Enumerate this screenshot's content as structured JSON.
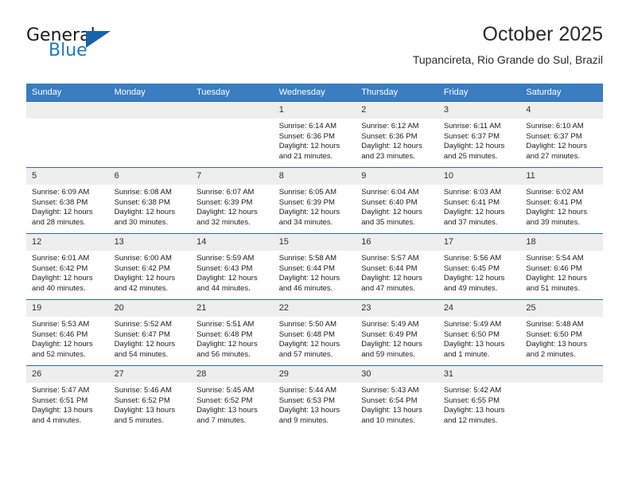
{
  "logo": {
    "word1": "General",
    "word2": "Blue",
    "triangle_icon": "blue-triangle-icon",
    "color_dark": "#1b1b1b",
    "color_blue": "#1f7ac0",
    "color_triangle": "#1863a8"
  },
  "header": {
    "title": "October 2025",
    "subtitle": "Tupancireta, Rio Grande do Sul, Brazil"
  },
  "colors": {
    "header_row_bg": "#3a7dc0",
    "daynum_bg": "#eeeeee",
    "row_border": "#2d6ca8",
    "text": "#1c1c1c"
  },
  "weekdays": [
    "Sunday",
    "Monday",
    "Tuesday",
    "Wednesday",
    "Thursday",
    "Friday",
    "Saturday"
  ],
  "weeks": [
    [
      {
        "day": "",
        "sunrise": "",
        "sunset": "",
        "daylight1": "",
        "daylight2": ""
      },
      {
        "day": "",
        "sunrise": "",
        "sunset": "",
        "daylight1": "",
        "daylight2": ""
      },
      {
        "day": "",
        "sunrise": "",
        "sunset": "",
        "daylight1": "",
        "daylight2": ""
      },
      {
        "day": "1",
        "sunrise": "Sunrise: 6:14 AM",
        "sunset": "Sunset: 6:36 PM",
        "daylight1": "Daylight: 12 hours",
        "daylight2": "and 21 minutes."
      },
      {
        "day": "2",
        "sunrise": "Sunrise: 6:12 AM",
        "sunset": "Sunset: 6:36 PM",
        "daylight1": "Daylight: 12 hours",
        "daylight2": "and 23 minutes."
      },
      {
        "day": "3",
        "sunrise": "Sunrise: 6:11 AM",
        "sunset": "Sunset: 6:37 PM",
        "daylight1": "Daylight: 12 hours",
        "daylight2": "and 25 minutes."
      },
      {
        "day": "4",
        "sunrise": "Sunrise: 6:10 AM",
        "sunset": "Sunset: 6:37 PM",
        "daylight1": "Daylight: 12 hours",
        "daylight2": "and 27 minutes."
      }
    ],
    [
      {
        "day": "5",
        "sunrise": "Sunrise: 6:09 AM",
        "sunset": "Sunset: 6:38 PM",
        "daylight1": "Daylight: 12 hours",
        "daylight2": "and 28 minutes."
      },
      {
        "day": "6",
        "sunrise": "Sunrise: 6:08 AM",
        "sunset": "Sunset: 6:38 PM",
        "daylight1": "Daylight: 12 hours",
        "daylight2": "and 30 minutes."
      },
      {
        "day": "7",
        "sunrise": "Sunrise: 6:07 AM",
        "sunset": "Sunset: 6:39 PM",
        "daylight1": "Daylight: 12 hours",
        "daylight2": "and 32 minutes."
      },
      {
        "day": "8",
        "sunrise": "Sunrise: 6:05 AM",
        "sunset": "Sunset: 6:39 PM",
        "daylight1": "Daylight: 12 hours",
        "daylight2": "and 34 minutes."
      },
      {
        "day": "9",
        "sunrise": "Sunrise: 6:04 AM",
        "sunset": "Sunset: 6:40 PM",
        "daylight1": "Daylight: 12 hours",
        "daylight2": "and 35 minutes."
      },
      {
        "day": "10",
        "sunrise": "Sunrise: 6:03 AM",
        "sunset": "Sunset: 6:41 PM",
        "daylight1": "Daylight: 12 hours",
        "daylight2": "and 37 minutes."
      },
      {
        "day": "11",
        "sunrise": "Sunrise: 6:02 AM",
        "sunset": "Sunset: 6:41 PM",
        "daylight1": "Daylight: 12 hours",
        "daylight2": "and 39 minutes."
      }
    ],
    [
      {
        "day": "12",
        "sunrise": "Sunrise: 6:01 AM",
        "sunset": "Sunset: 6:42 PM",
        "daylight1": "Daylight: 12 hours",
        "daylight2": "and 40 minutes."
      },
      {
        "day": "13",
        "sunrise": "Sunrise: 6:00 AM",
        "sunset": "Sunset: 6:42 PM",
        "daylight1": "Daylight: 12 hours",
        "daylight2": "and 42 minutes."
      },
      {
        "day": "14",
        "sunrise": "Sunrise: 5:59 AM",
        "sunset": "Sunset: 6:43 PM",
        "daylight1": "Daylight: 12 hours",
        "daylight2": "and 44 minutes."
      },
      {
        "day": "15",
        "sunrise": "Sunrise: 5:58 AM",
        "sunset": "Sunset: 6:44 PM",
        "daylight1": "Daylight: 12 hours",
        "daylight2": "and 46 minutes."
      },
      {
        "day": "16",
        "sunrise": "Sunrise: 5:57 AM",
        "sunset": "Sunset: 6:44 PM",
        "daylight1": "Daylight: 12 hours",
        "daylight2": "and 47 minutes."
      },
      {
        "day": "17",
        "sunrise": "Sunrise: 5:56 AM",
        "sunset": "Sunset: 6:45 PM",
        "daylight1": "Daylight: 12 hours",
        "daylight2": "and 49 minutes."
      },
      {
        "day": "18",
        "sunrise": "Sunrise: 5:54 AM",
        "sunset": "Sunset: 6:46 PM",
        "daylight1": "Daylight: 12 hours",
        "daylight2": "and 51 minutes."
      }
    ],
    [
      {
        "day": "19",
        "sunrise": "Sunrise: 5:53 AM",
        "sunset": "Sunset: 6:46 PM",
        "daylight1": "Daylight: 12 hours",
        "daylight2": "and 52 minutes."
      },
      {
        "day": "20",
        "sunrise": "Sunrise: 5:52 AM",
        "sunset": "Sunset: 6:47 PM",
        "daylight1": "Daylight: 12 hours",
        "daylight2": "and 54 minutes."
      },
      {
        "day": "21",
        "sunrise": "Sunrise: 5:51 AM",
        "sunset": "Sunset: 6:48 PM",
        "daylight1": "Daylight: 12 hours",
        "daylight2": "and 56 minutes."
      },
      {
        "day": "22",
        "sunrise": "Sunrise: 5:50 AM",
        "sunset": "Sunset: 6:48 PM",
        "daylight1": "Daylight: 12 hours",
        "daylight2": "and 57 minutes."
      },
      {
        "day": "23",
        "sunrise": "Sunrise: 5:49 AM",
        "sunset": "Sunset: 6:49 PM",
        "daylight1": "Daylight: 12 hours",
        "daylight2": "and 59 minutes."
      },
      {
        "day": "24",
        "sunrise": "Sunrise: 5:49 AM",
        "sunset": "Sunset: 6:50 PM",
        "daylight1": "Daylight: 13 hours",
        "daylight2": "and 1 minute."
      },
      {
        "day": "25",
        "sunrise": "Sunrise: 5:48 AM",
        "sunset": "Sunset: 6:50 PM",
        "daylight1": "Daylight: 13 hours",
        "daylight2": "and 2 minutes."
      }
    ],
    [
      {
        "day": "26",
        "sunrise": "Sunrise: 5:47 AM",
        "sunset": "Sunset: 6:51 PM",
        "daylight1": "Daylight: 13 hours",
        "daylight2": "and 4 minutes."
      },
      {
        "day": "27",
        "sunrise": "Sunrise: 5:46 AM",
        "sunset": "Sunset: 6:52 PM",
        "daylight1": "Daylight: 13 hours",
        "daylight2": "and 5 minutes."
      },
      {
        "day": "28",
        "sunrise": "Sunrise: 5:45 AM",
        "sunset": "Sunset: 6:52 PM",
        "daylight1": "Daylight: 13 hours",
        "daylight2": "and 7 minutes."
      },
      {
        "day": "29",
        "sunrise": "Sunrise: 5:44 AM",
        "sunset": "Sunset: 6:53 PM",
        "daylight1": "Daylight: 13 hours",
        "daylight2": "and 9 minutes."
      },
      {
        "day": "30",
        "sunrise": "Sunrise: 5:43 AM",
        "sunset": "Sunset: 6:54 PM",
        "daylight1": "Daylight: 13 hours",
        "daylight2": "and 10 minutes."
      },
      {
        "day": "31",
        "sunrise": "Sunrise: 5:42 AM",
        "sunset": "Sunset: 6:55 PM",
        "daylight1": "Daylight: 13 hours",
        "daylight2": "and 12 minutes."
      },
      {
        "day": "",
        "sunrise": "",
        "sunset": "",
        "daylight1": "",
        "daylight2": ""
      }
    ]
  ]
}
